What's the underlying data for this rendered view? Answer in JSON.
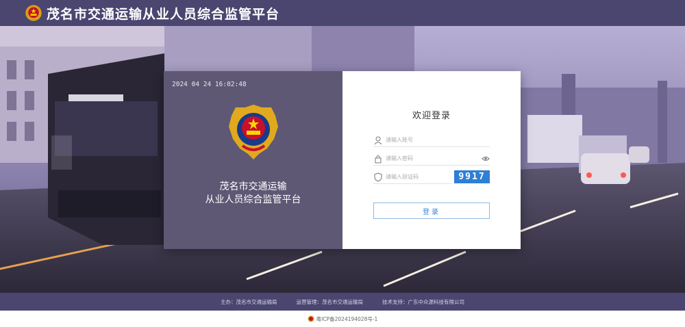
{
  "header": {
    "title": "茂名市交通运输从业人员综合监管平台",
    "emblem_icon": "national-emblem-icon"
  },
  "card": {
    "datetime": "2024 04 24 16:02:48",
    "platform_name_line1": "茂名市交通运输",
    "platform_name_line2": "从业人员综合监管平台",
    "welcome": "欢迎登录",
    "username_placeholder": "请输入账号",
    "password_placeholder": "请输入密码",
    "captcha_placeholder": "请输入验证码",
    "captcha_code": "9917",
    "login_label": "登录"
  },
  "footer": {
    "host": "主办：茂名市交通运输局",
    "operator": "运营管理：茂名市交通运输局",
    "tech_support": "技术支持：广东中众源科技有限公司",
    "icp": "粤ICP备2024194028号-1"
  },
  "colors": {
    "header_bg": "#4a4670",
    "left_panel_bg": "#5e5874",
    "captcha_bg": "#2f7fd4",
    "login_button_text": "#3a86d4"
  }
}
